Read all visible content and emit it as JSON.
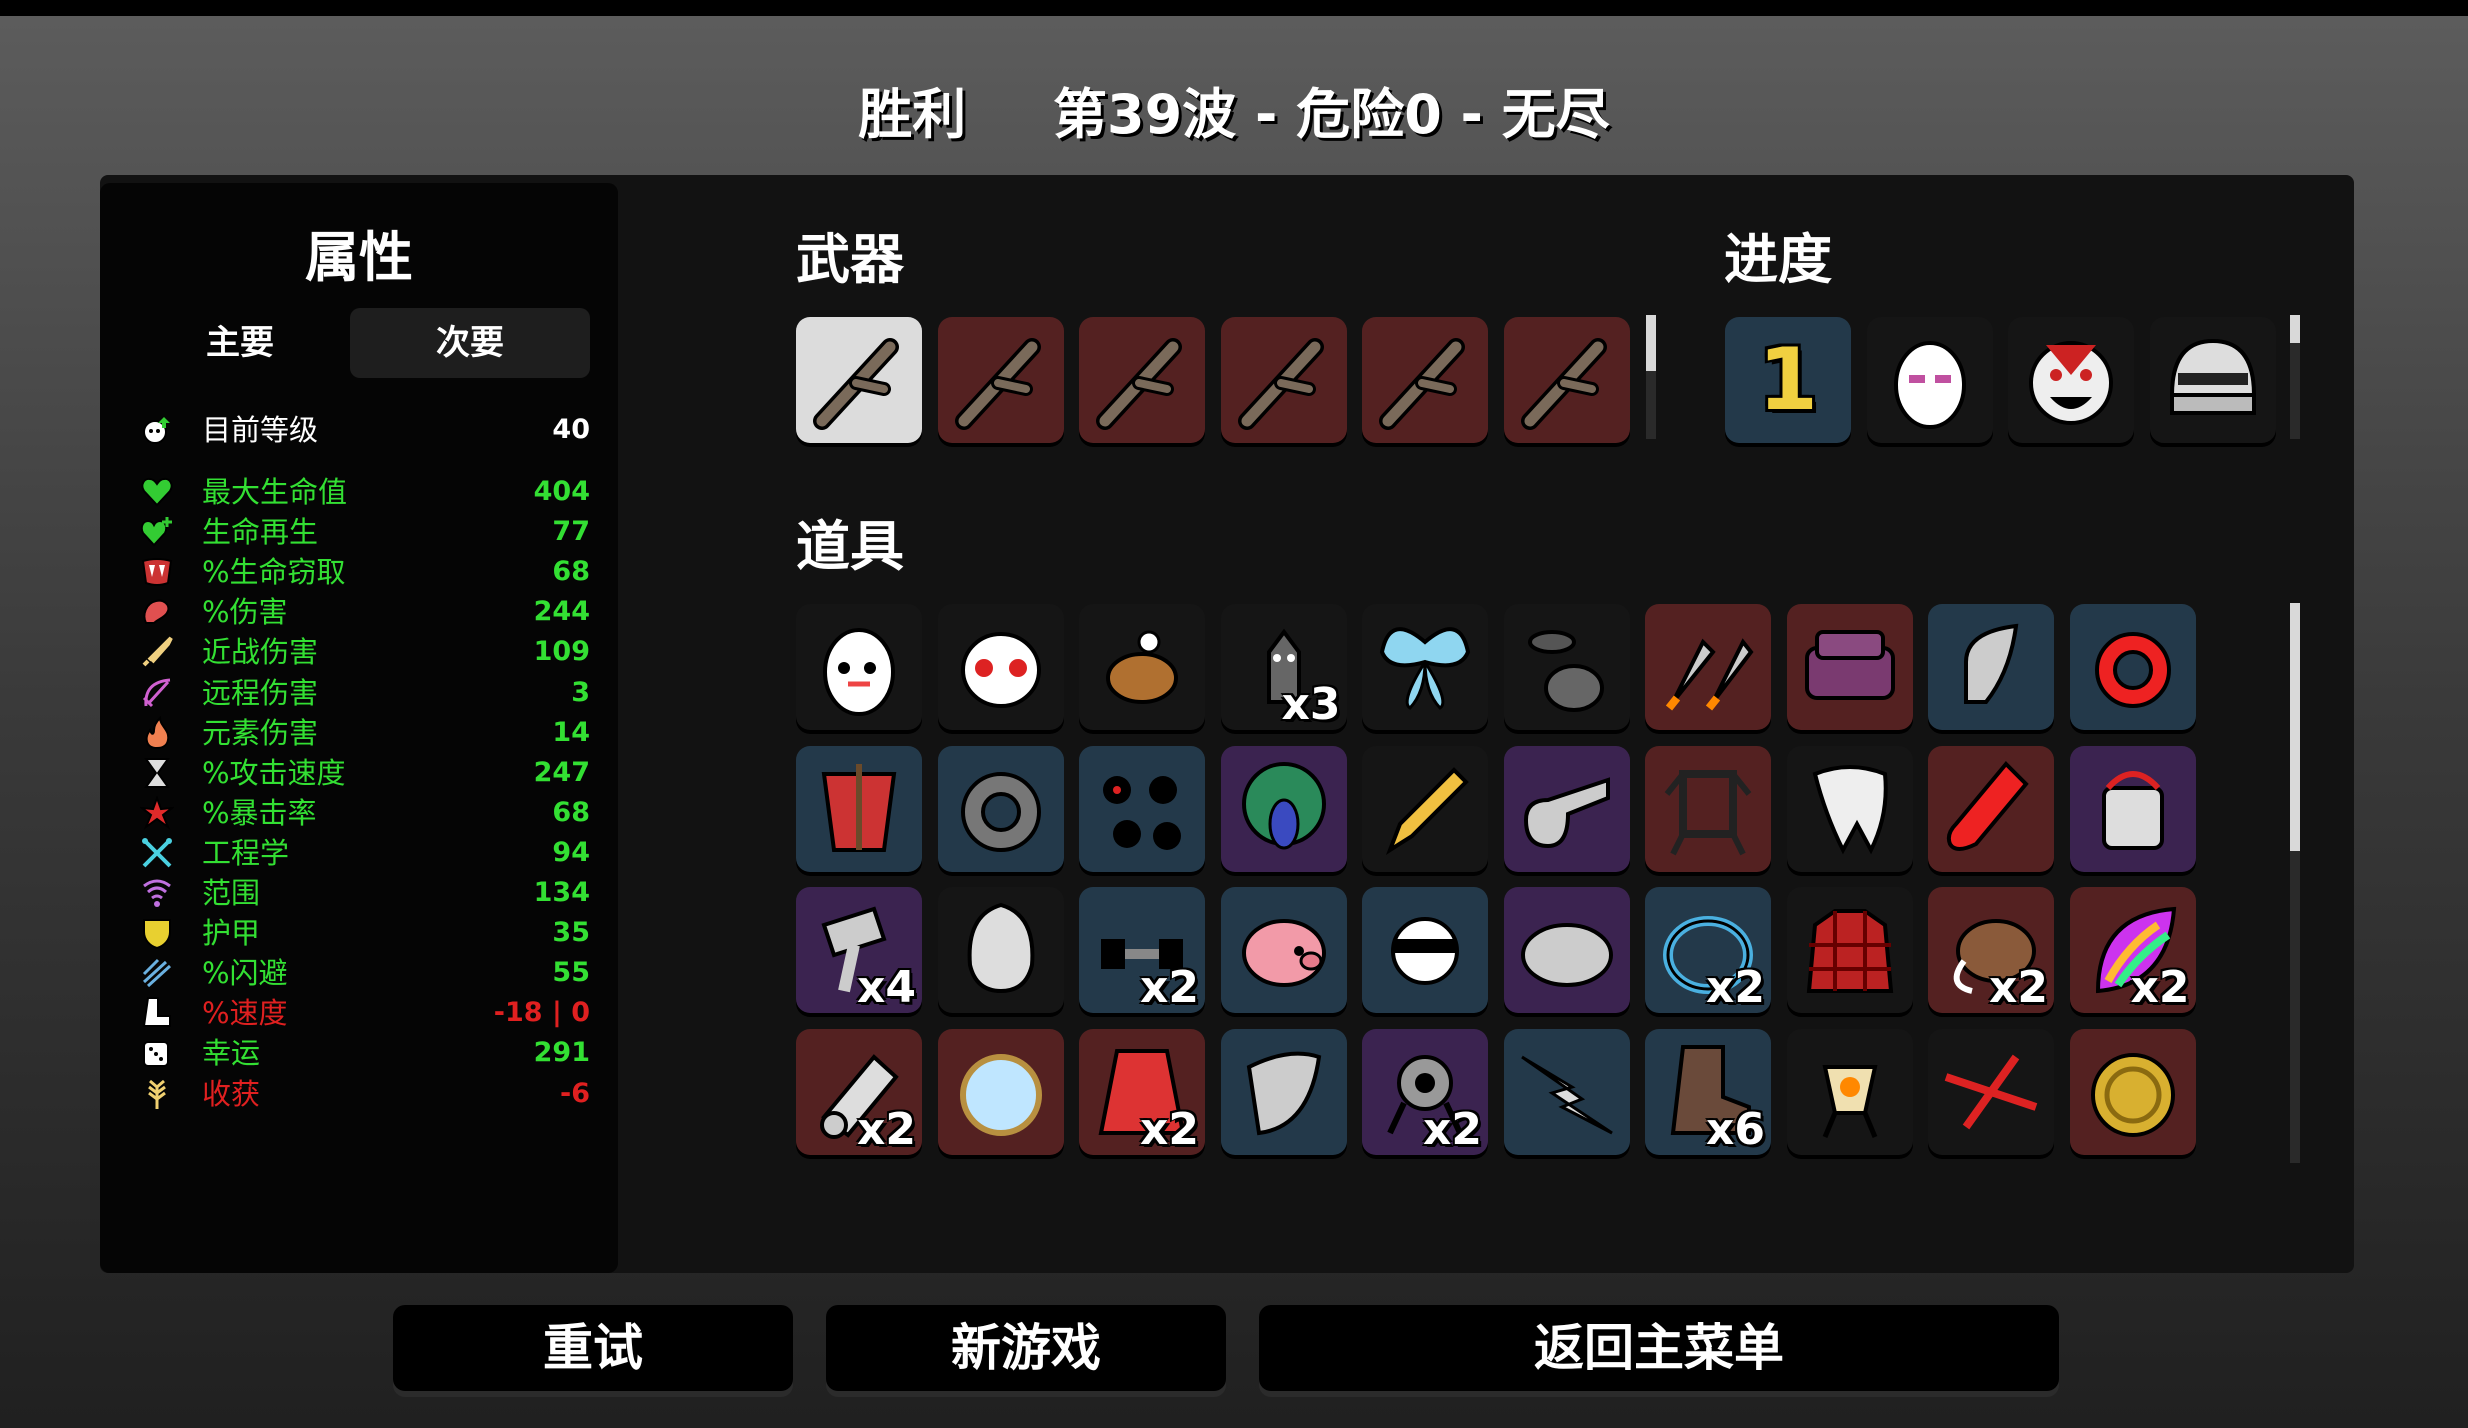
{
  "header": {
    "result": "胜利",
    "wave_info": "第39波 - 危险0 - 无尽"
  },
  "stats_panel": {
    "title": "属性",
    "tabs": {
      "primary": "主要",
      "secondary": "次要"
    },
    "level": {
      "label": "目前等级",
      "value": "40",
      "icon": "level-up-icon"
    },
    "rows": [
      {
        "label": "最大生命值",
        "value": "404",
        "color": "#33e033",
        "icon": "heart-icon"
      },
      {
        "label": "生命再生",
        "value": "77",
        "color": "#33e033",
        "icon": "heart-regen-icon"
      },
      {
        "label": "%生命窃取",
        "value": "68",
        "color": "#33e033",
        "icon": "vampire-teeth-icon"
      },
      {
        "label": "%伤害",
        "value": "244",
        "color": "#33e033",
        "icon": "muscle-icon"
      },
      {
        "label": "近战伤害",
        "value": "109",
        "color": "#33e033",
        "icon": "sword-icon"
      },
      {
        "label": "远程伤害",
        "value": "3",
        "color": "#33e033",
        "icon": "bow-icon"
      },
      {
        "label": "元素伤害",
        "value": "14",
        "color": "#33e033",
        "icon": "flame-icon"
      },
      {
        "label": "%攻击速度",
        "value": "247",
        "color": "#33e033",
        "icon": "hourglass-icon"
      },
      {
        "label": "%暴击率",
        "value": "68",
        "color": "#33e033",
        "icon": "crit-star-icon"
      },
      {
        "label": "工程学",
        "value": "94",
        "color": "#33e033",
        "icon": "wrench-icon"
      },
      {
        "label": "范围",
        "value": "134",
        "color": "#33e033",
        "icon": "range-icon"
      },
      {
        "label": "护甲",
        "value": "35",
        "color": "#33e033",
        "icon": "shield-icon"
      },
      {
        "label": "%闪避",
        "value": "55",
        "color": "#33e033",
        "icon": "dodge-icon"
      },
      {
        "label": "%速度",
        "value": "-18 | 0",
        "color": "#e02020",
        "icon": "boot-icon"
      },
      {
        "label": "幸运",
        "value": "291",
        "color": "#33e033",
        "icon": "dice-icon"
      },
      {
        "label": "收获",
        "value": "-6",
        "color": "#e02020",
        "icon": "wheat-icon"
      }
    ]
  },
  "weapons": {
    "title": "武器",
    "items": [
      {
        "name": "stick-icon",
        "tier": "white"
      },
      {
        "name": "stick-icon",
        "tier": "red"
      },
      {
        "name": "stick-icon",
        "tier": "red"
      },
      {
        "name": "stick-icon",
        "tier": "red"
      },
      {
        "name": "stick-icon",
        "tier": "red"
      },
      {
        "name": "stick-icon",
        "tier": "red"
      }
    ]
  },
  "progress": {
    "title": "进度",
    "items": [
      {
        "name": "danger-number-icon",
        "text": "1",
        "tier": "blue"
      },
      {
        "name": "egg-sunglasses-icon",
        "tier": "black"
      },
      {
        "name": "boss-mask-icon",
        "tier": "black"
      },
      {
        "name": "helmet-icon",
        "tier": "black"
      }
    ]
  },
  "items": {
    "title": "道具",
    "rows": [
      [
        {
          "name": "egg-pet-icon",
          "tier": "black",
          "count": ""
        },
        {
          "name": "ghost-mask-icon",
          "tier": "black",
          "count": ""
        },
        {
          "name": "squirrel-icon",
          "tier": "black",
          "count": ""
        },
        {
          "name": "bat-icon",
          "tier": "black",
          "count": "x3"
        },
        {
          "name": "butterfly-icon",
          "tier": "black",
          "count": ""
        },
        {
          "name": "landmine-icon",
          "tier": "black",
          "count": ""
        },
        {
          "name": "rockets-icon",
          "tier": "red",
          "count": ""
        },
        {
          "name": "couch-icon",
          "tier": "red",
          "count": ""
        },
        {
          "name": "bullet-icon",
          "tier": "blue",
          "count": ""
        },
        {
          "name": "target-ring-icon",
          "tier": "blue",
          "count": ""
        }
      ],
      [
        {
          "name": "scarecrow-icon",
          "tier": "blue",
          "count": ""
        },
        {
          "name": "gear-icon",
          "tier": "blue",
          "count": ""
        },
        {
          "name": "bombs-icon",
          "tier": "blue",
          "count": ""
        },
        {
          "name": "peacock-icon",
          "tier": "purple",
          "count": ""
        },
        {
          "name": "pencil-icon",
          "tier": "black",
          "count": ""
        },
        {
          "name": "whistle-icon",
          "tier": "purple",
          "count": ""
        },
        {
          "name": "robot-frame-icon",
          "tier": "red",
          "count": ""
        },
        {
          "name": "tooth-icon",
          "tier": "black",
          "count": ""
        },
        {
          "name": "potion-icon",
          "tier": "red",
          "count": ""
        },
        {
          "name": "jar-icon",
          "tier": "purple",
          "count": ""
        }
      ],
      [
        {
          "name": "hammer-icon",
          "tier": "purple",
          "count": "x4"
        },
        {
          "name": "alien-icon",
          "tier": "black",
          "count": ""
        },
        {
          "name": "dumbbell-icon",
          "tier": "blue",
          "count": "x2"
        },
        {
          "name": "piggy-bank-icon",
          "tier": "blue",
          "count": ""
        },
        {
          "name": "ninja-icon",
          "tier": "blue",
          "count": ""
        },
        {
          "name": "tardigrade-icon",
          "tier": "purple",
          "count": ""
        },
        {
          "name": "bracelet-icon",
          "tier": "blue",
          "count": "x2"
        },
        {
          "name": "plaid-shirt-icon",
          "tier": "black",
          "count": ""
        },
        {
          "name": "mammoth-icon",
          "tier": "red",
          "count": "x2"
        },
        {
          "name": "rainbow-leaf-icon",
          "tier": "red",
          "count": "x2"
        }
      ],
      [
        {
          "name": "scroll-icon",
          "tier": "red",
          "count": "x2"
        },
        {
          "name": "crystal-ball-icon",
          "tier": "red",
          "count": ""
        },
        {
          "name": "cape-icon",
          "tier": "red",
          "count": "x2"
        },
        {
          "name": "blade-guard-icon",
          "tier": "blue",
          "count": ""
        },
        {
          "name": "turret-icon",
          "tier": "purple",
          "count": "x2"
        },
        {
          "name": "lightning-icon",
          "tier": "blue",
          "count": ""
        },
        {
          "name": "boot-item-icon",
          "tier": "blue",
          "count": "x6"
        },
        {
          "name": "lamp-icon",
          "tier": "black",
          "count": ""
        },
        {
          "name": "thorn-icon",
          "tier": "black",
          "count": ""
        },
        {
          "name": "gold-coin-icon",
          "tier": "red",
          "count": ""
        }
      ]
    ]
  },
  "buttons": {
    "retry": "重试",
    "new_game": "新游戏",
    "main_menu": "返回主菜单"
  },
  "tier_colors": {
    "white": "#dcdcdc",
    "black": "#151515",
    "red": "#542121",
    "blue": "#23394a",
    "purple": "#3b2350"
  }
}
